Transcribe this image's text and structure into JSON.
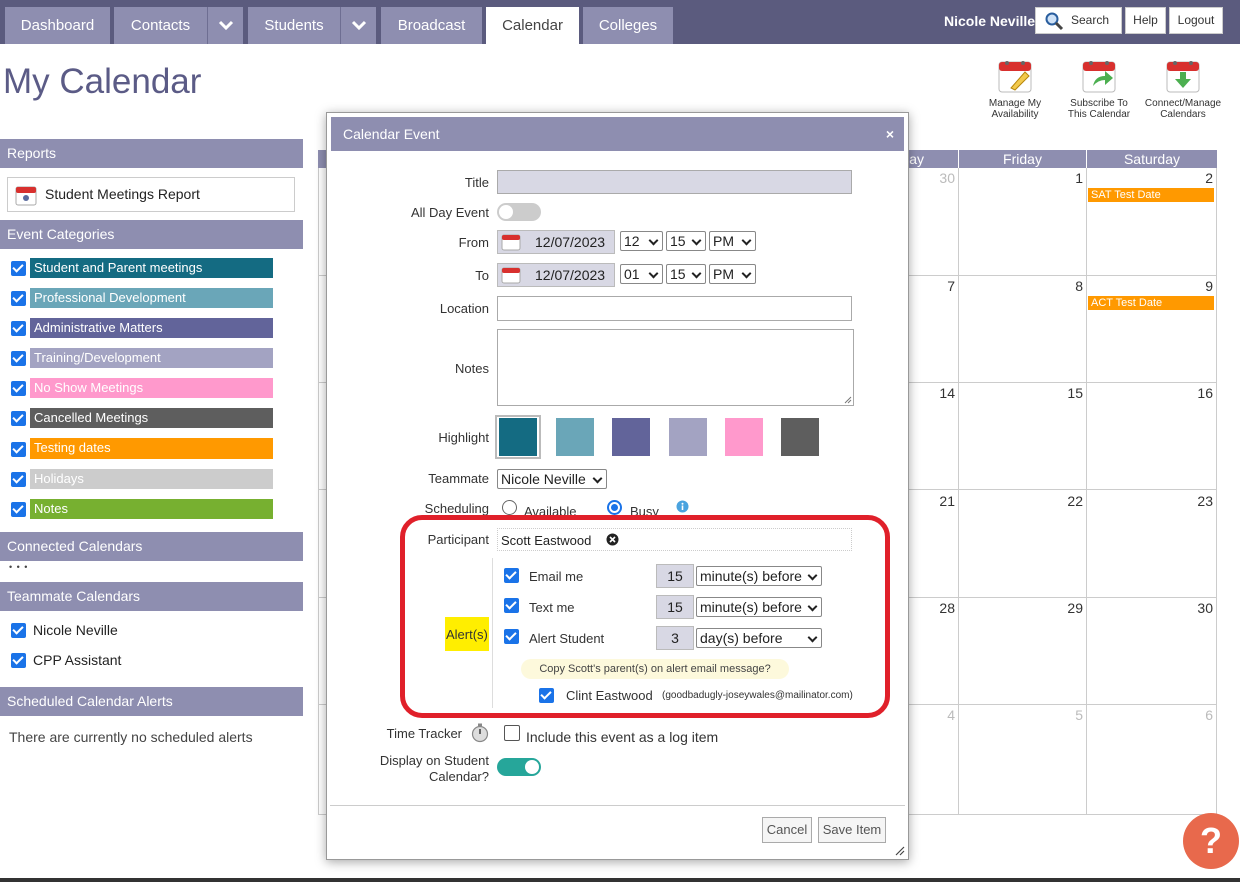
{
  "nav": {
    "tabs": [
      "Dashboard",
      "Contacts",
      "Students",
      "Broadcast",
      "Calendar",
      "Colleges"
    ],
    "user": "Nicole Neville",
    "search": "Search",
    "help": "Help",
    "logout": "Logout"
  },
  "page_title": "My Calendar",
  "tools": {
    "availability": [
      "Manage My",
      "Availability"
    ],
    "subscribe": [
      "Subscribe To",
      "This Calendar"
    ],
    "connect": [
      "Connect/Manage",
      "Calendars"
    ]
  },
  "sidebar": {
    "reports_header": "Reports",
    "report_item": "Student Meetings Report",
    "categories_header": "Event Categories",
    "categories": [
      {
        "label": "Student and Parent meetings",
        "color": "#146b82"
      },
      {
        "label": "Professional Development",
        "color": "#6aa6b8"
      },
      {
        "label": "Administrative Matters",
        "color": "#62649a"
      },
      {
        "label": "Training/Development",
        "color": "#a3a3c2"
      },
      {
        "label": "No Show Meetings",
        "color": "#ff99cc"
      },
      {
        "label": "Cancelled Meetings",
        "color": "#5e5e5e"
      },
      {
        "label": "Testing dates",
        "color": "#ff9900"
      },
      {
        "label": "Holidays",
        "color": "#cccccc"
      },
      {
        "label": "Notes",
        "color": "#77b030"
      }
    ],
    "connected_header": "Connected Calendars",
    "connected_dots": "• • •",
    "teammate_header": "Teammate Calendars",
    "teammates": [
      "Nicole Neville",
      "CPP Assistant"
    ],
    "alerts_header": "Scheduled Calendar Alerts",
    "alerts_text": "There are currently no scheduled alerts"
  },
  "calendar": {
    "headers": {
      "thursday_partial": "ay",
      "friday": "Friday",
      "saturday": "Saturday"
    },
    "days": {
      "r1": [
        "30",
        "1",
        "2"
      ],
      "r2": [
        "7",
        "8",
        "9"
      ],
      "r3": [
        "14",
        "15",
        "16"
      ],
      "r4": [
        "21",
        "22",
        "23"
      ],
      "r5": [
        "28",
        "29",
        "30"
      ],
      "r6": [
        "4",
        "5",
        "6"
      ]
    },
    "events": {
      "sat_test": "SAT Test Date",
      "act_test": "ACT Test Date"
    }
  },
  "modal": {
    "title": "Calendar Event",
    "close": "×",
    "labels": {
      "title": "Title",
      "all_day": "All Day Event",
      "from": "From",
      "to": "To",
      "location": "Location",
      "notes": "Notes",
      "highlight": "Highlight",
      "teammate": "Teammate",
      "scheduling": "Scheduling",
      "participant": "Participant",
      "alerts": "Alert(s)",
      "time_tracker": "Time Tracker",
      "display_1": "Display on Student",
      "display_2": "Calendar?"
    },
    "from": {
      "date": "12/07/2023",
      "hour": "12",
      "minute": "15",
      "ampm": "PM"
    },
    "to": {
      "date": "12/07/2023",
      "hour": "01",
      "minute": "15",
      "ampm": "PM"
    },
    "highlight_colors": [
      "#146b82",
      "#6aa6b8",
      "#62649a",
      "#a3a3c2",
      "#ff99cc",
      "#5e5e5e"
    ],
    "teammate_value": "Nicole Neville",
    "scheduling": {
      "available": "Available",
      "busy": "Busy",
      "selected": "busy"
    },
    "participant_name": "Scott Eastwood",
    "alerts": [
      {
        "label": "Email me",
        "amount": "15",
        "unit": "minute(s) before"
      },
      {
        "label": "Text me",
        "amount": "15",
        "unit": "minute(s) before"
      },
      {
        "label": "Alert Student",
        "amount": "3",
        "unit": "day(s) before"
      }
    ],
    "copy_parent_note": "Copy Scott's parent(s) on alert email message?",
    "parent_name": "Clint Eastwood",
    "parent_email": "(goodbadugly-joseywales@mailinator.com)",
    "time_tracker_text": "Include this event as a log item",
    "cancel": "Cancel",
    "save": "Save Item"
  },
  "help_icon": "?"
}
